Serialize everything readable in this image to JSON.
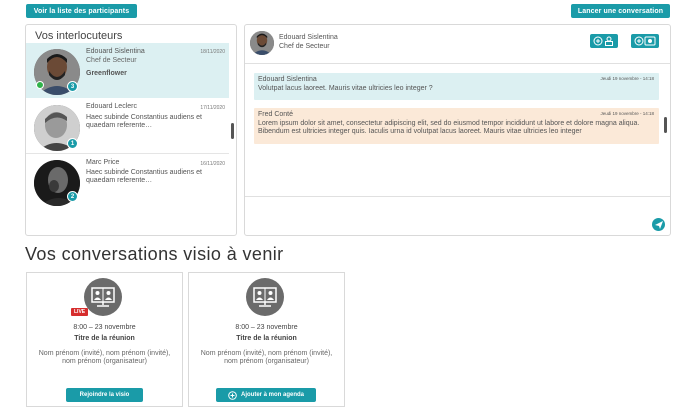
{
  "top": {
    "participants_button": "Voir la liste des participants",
    "new_conversation_button": "Lancer une conversation"
  },
  "contacts": {
    "title": "Vos interlocuteurs",
    "items": [
      {
        "name": "Edouard Sislentina",
        "date": "18/11/2020",
        "role": "Chef de Secteur",
        "company": "Greenflower",
        "badge": "3",
        "online": true
      },
      {
        "name": "Edouard Leclerc",
        "date": "17/11/2020",
        "message": "Haec subinde Constantius audiens et quaedam referente…",
        "badge": "1"
      },
      {
        "name": "Marc Price",
        "date": "16/11/2020",
        "message": "Haec subinde Constantius audiens et quaedam referente…",
        "badge": "2"
      }
    ]
  },
  "chat": {
    "name": "Edouard Sislentina",
    "role": "Chef de Secteur",
    "messages": [
      {
        "author": "Edouard Sislentina",
        "time": "Jeudi 19 novembre - 14:18",
        "text": "Volutpat lacus laoreet. Mauris vitae ultricies leo integer ?"
      },
      {
        "author": "Fred Conté",
        "time": "Jeudi 19 novembre - 14:18",
        "text": "Lorem ipsum dolor sit amet, consectetur adipiscing elit, sed do eiusmod tempor incididunt ut labore et dolore magna aliqua. Bibendum est ultricies integer quis. Iaculis urna id volutpat lacus laoreet. Mauris vitae ultricies leo integer"
      }
    ],
    "icons": [
      "add-user-icon",
      "video-call-icon",
      "send-icon"
    ]
  },
  "upcoming": {
    "title": "Vos conversations visio à venir",
    "cards": [
      {
        "live": "LIVE",
        "time": "8:00 – 23 novembre",
        "title": "Titre de la réunion",
        "people": "Nom prénom (invité), nom prénom (invité), nom prénom (organisateur)",
        "button": "Rejoindre la visio"
      },
      {
        "time": "8:00 – 23 novembre",
        "title": "Titre de la réunion",
        "people": "Nom prénom (invité), nom prénom (invité), nom prénom (organisateur)",
        "button": "Ajouter à mon agenda"
      }
    ]
  },
  "colors": {
    "accent": "#1a9ba8",
    "active_bg": "#dcf0f2",
    "peach_bg": "#fbe9d8",
    "live": "#d62d2d",
    "online": "#2fb24a"
  }
}
